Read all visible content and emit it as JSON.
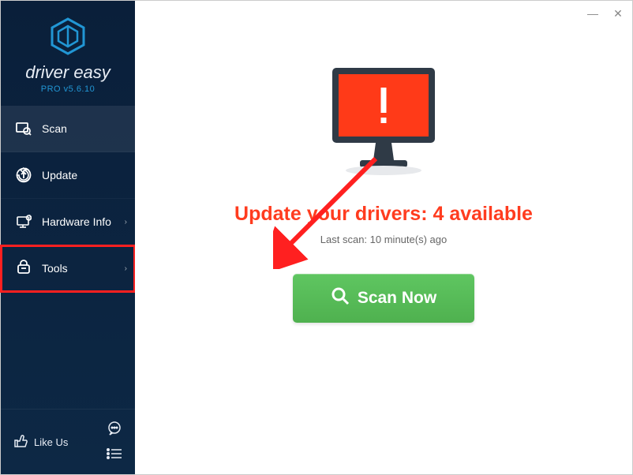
{
  "app": {
    "name": "driver easy",
    "version_label": "PRO v5.6.10"
  },
  "sidebar": {
    "items": [
      {
        "label": "Scan",
        "icon": "scan-icon",
        "has_submenu": false
      },
      {
        "label": "Update",
        "icon": "update-icon",
        "has_submenu": false
      },
      {
        "label": "Hardware Info",
        "icon": "hardware-icon",
        "has_submenu": true
      },
      {
        "label": "Tools",
        "icon": "tools-icon",
        "has_submenu": true,
        "highlighted": true
      }
    ],
    "like_label": "Like Us"
  },
  "main": {
    "headline": "Update your drivers: 4 available",
    "subtext": "Last scan: 10 minute(s) ago",
    "scan_button_label": "Scan Now"
  },
  "colors": {
    "sidebar_bg": "#0d2845",
    "accent_red": "#ff3c1f",
    "monitor_red": "#ff3a18",
    "button_green": "#4fb14f",
    "highlight_red": "#ff2020"
  }
}
